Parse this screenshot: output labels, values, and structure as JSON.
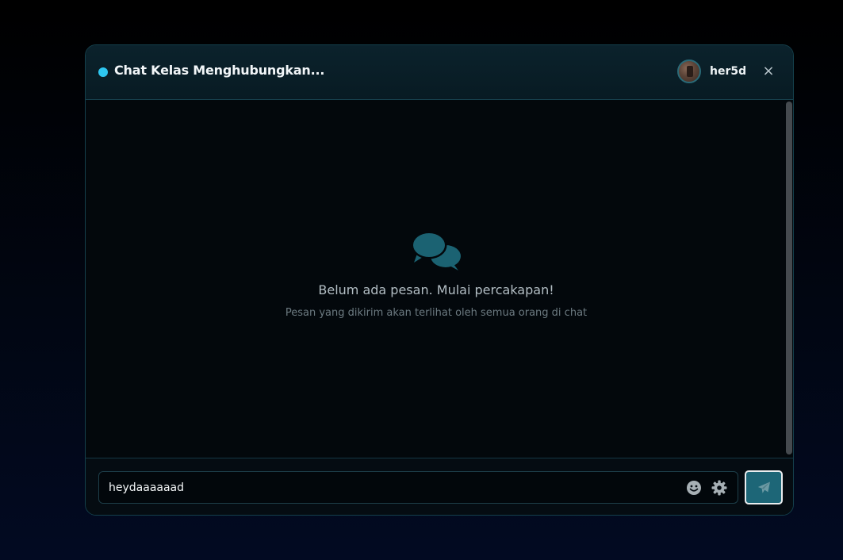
{
  "header": {
    "title": "Chat Kelas Menghubungkan...",
    "username": "her5d",
    "close_label": "×",
    "status_color": "#2ec7f0"
  },
  "empty_state": {
    "icon": "chat-bubbles-icon",
    "title": "Belum ada pesan. Mulai percakapan!",
    "subtitle": "Pesan yang dikirim akan terlihat oleh semua orang di chat"
  },
  "composer": {
    "input_value": "heydaaaaaad",
    "emoji_icon": "smiley-icon",
    "settings_icon": "gear-icon",
    "send_icon": "paper-plane-icon"
  },
  "colors": {
    "accent": "#1d6677",
    "icon_accent": "#1b6272"
  }
}
